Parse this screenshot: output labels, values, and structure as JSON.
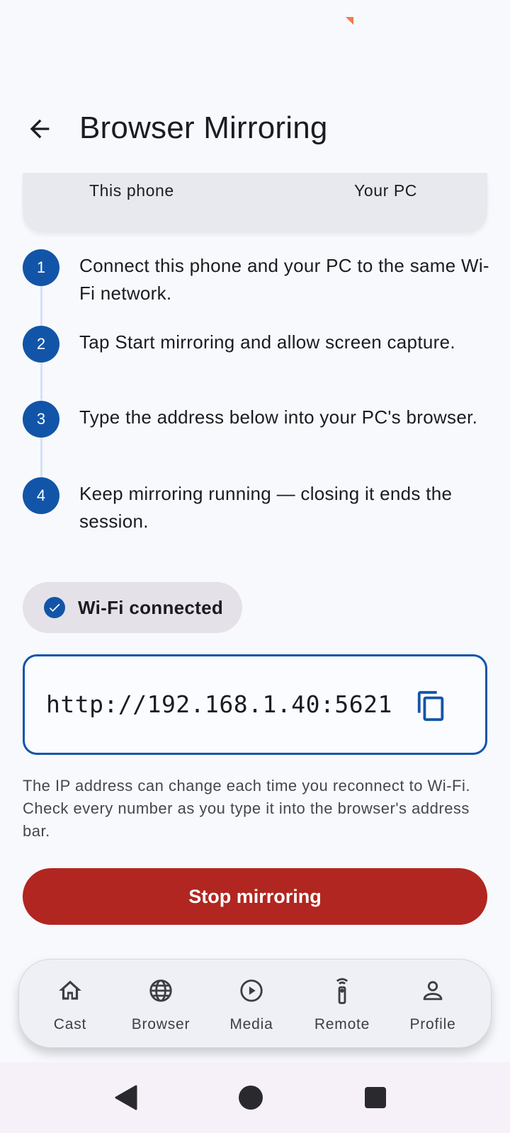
{
  "header": {
    "title": "Browser Mirroring"
  },
  "devices": {
    "phone_label": "This phone",
    "pc_label": "Your PC"
  },
  "steps": [
    {
      "num": "1",
      "text": "Connect this phone and your PC to the same Wi-Fi network."
    },
    {
      "num": "2",
      "text": "Tap Start mirroring and allow screen capture."
    },
    {
      "num": "3",
      "text": "Type the address below into your PC's browser."
    },
    {
      "num": "4",
      "text": "Keep mirroring running — closing it ends the session."
    }
  ],
  "wifi_status": {
    "label": "Wi-Fi connected",
    "icon": "check-circle-icon"
  },
  "address": {
    "url": "http://192.168.1.40:5621",
    "copy_icon": "copy-icon"
  },
  "hint": "The IP address can change each time you reconnect to Wi-Fi. Check every number as you type it into the browser's address bar.",
  "actions": {
    "stop_label": "Stop mirroring"
  },
  "nav": [
    {
      "label": "Cast",
      "icon": "home-icon"
    },
    {
      "label": "Browser",
      "icon": "globe-icon"
    },
    {
      "label": "Media",
      "icon": "play-circle-icon"
    },
    {
      "label": "Remote",
      "icon": "remote-icon"
    },
    {
      "label": "Profile",
      "icon": "person-icon"
    }
  ],
  "colors": {
    "accent": "#1255a8",
    "danger": "#b12620",
    "background": "#f8f9fd"
  }
}
